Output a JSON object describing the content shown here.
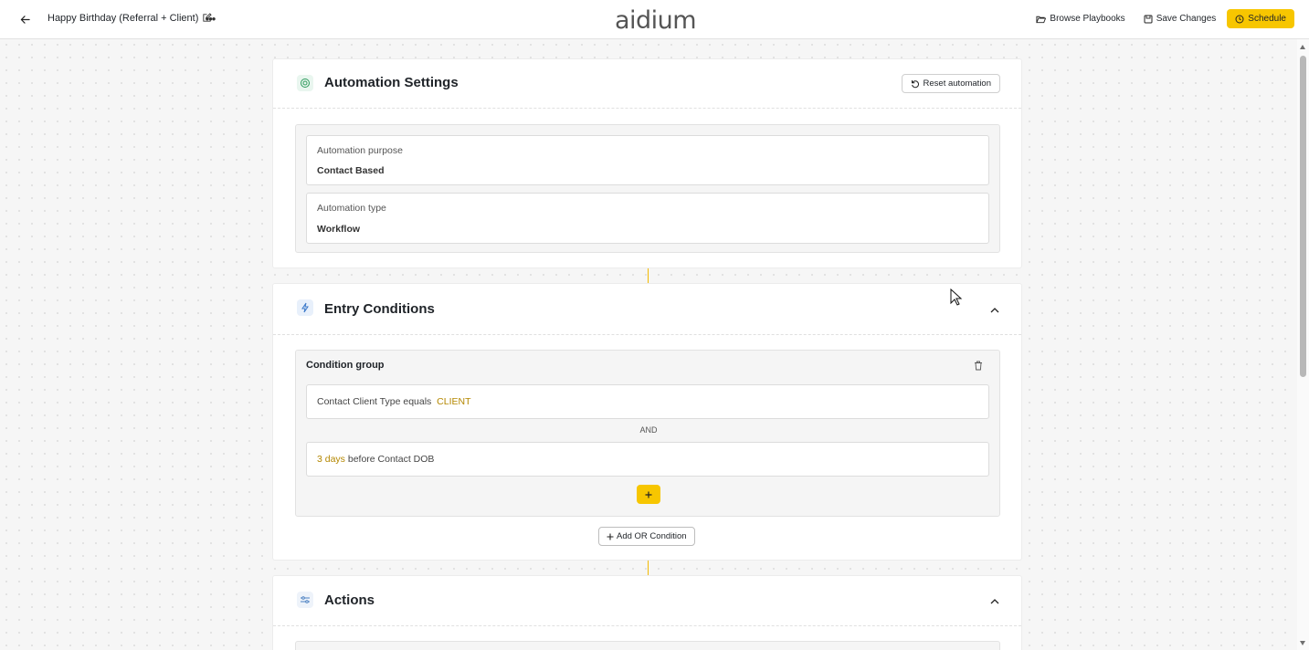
{
  "header": {
    "title": "Happy Birthday (Referral + Client)",
    "logo": "aidium",
    "browse_label": "Browse Playbooks",
    "save_label": "Save Changes",
    "schedule_label": "Schedule"
  },
  "settings": {
    "title": "Automation Settings",
    "reset_label": "Reset automation",
    "purpose_label": "Automation purpose",
    "purpose_value": "Contact Based",
    "type_label": "Automation type",
    "type_value": "Workflow"
  },
  "entry": {
    "title": "Entry Conditions",
    "group_title": "Condition group",
    "conditions": [
      {
        "prefix": "Contact Client Type equals",
        "highlight": "CLIENT",
        "suffix": ""
      },
      {
        "prefix": "",
        "highlight": "3 days",
        "suffix": "before Contact DOB"
      }
    ],
    "and_label": "AND",
    "add_or_label": "Add OR Condition"
  },
  "actions": {
    "title": "Actions"
  },
  "colors": {
    "accent": "#f7c600",
    "highlight_text": "#b48700",
    "connector": "#f3b900"
  },
  "icons": {
    "back": "arrow-left-icon",
    "edit": "pencil-icon",
    "more": "more-horizontal-icon",
    "browse": "folder-open-icon",
    "save": "save-icon",
    "schedule": "clock-icon",
    "reset": "rotate-ccw-icon",
    "settings": "settings-target-icon",
    "entry": "lightning-icon",
    "actions": "sliders-icon",
    "chevron": "chevron-up-icon",
    "trash": "trash-icon",
    "plus": "plus-icon"
  }
}
